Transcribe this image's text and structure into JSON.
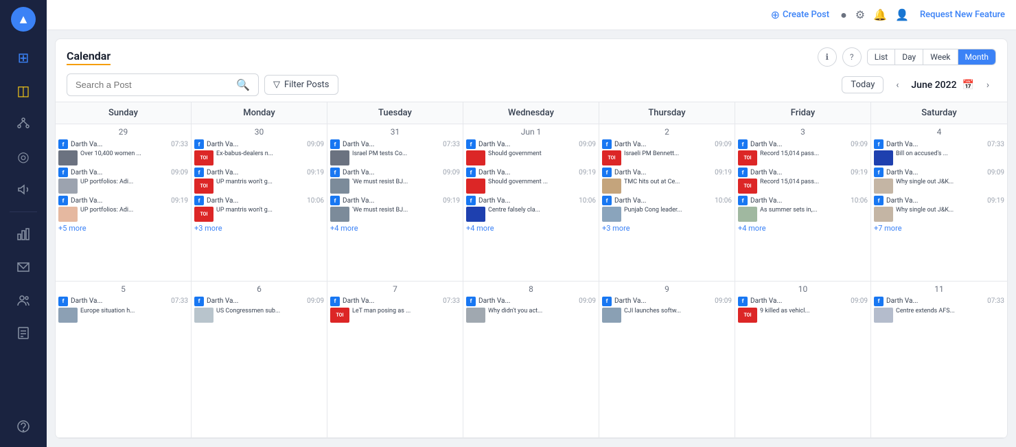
{
  "sidebar": {
    "logo_icon": "▲",
    "items": [
      {
        "id": "dashboard",
        "icon": "⊞",
        "active": false
      },
      {
        "id": "posts",
        "icon": "◫",
        "active": true,
        "color": "yellow"
      },
      {
        "id": "network",
        "icon": "✦",
        "active": false
      },
      {
        "id": "target",
        "icon": "◎",
        "active": false
      },
      {
        "id": "megaphone",
        "icon": "📣",
        "active": false
      },
      {
        "id": "analytics",
        "icon": "📊",
        "active": false
      },
      {
        "id": "inbox",
        "icon": "📥",
        "active": false
      },
      {
        "id": "team",
        "icon": "👥",
        "active": false
      },
      {
        "id": "reports",
        "icon": "📋",
        "active": false
      },
      {
        "id": "support",
        "icon": "🎧",
        "active": false
      }
    ]
  },
  "topbar": {
    "create_post": "Create Post",
    "request_feature": "Request New Feature"
  },
  "calendar": {
    "title": "Calendar",
    "search_placeholder": "Search a Post",
    "filter_label": "Filter Posts",
    "today_label": "Today",
    "month_label": "June 2022",
    "view_tabs": [
      "List",
      "Day",
      "Week",
      "Month"
    ],
    "active_view": "Month",
    "day_headers": [
      "Sunday",
      "Monday",
      "Tuesday",
      "Wednesday",
      "Thursday",
      "Friday",
      "Saturday"
    ],
    "weeks": [
      {
        "days": [
          {
            "date": "29",
            "posts": [
              {
                "source": "fb",
                "title": "Darth Va...",
                "time": "07:33",
                "thumb": "gray",
                "content": "Over 10,400 women ..."
              },
              {
                "source": "fb",
                "title": "Darth Va...",
                "time": "09:09",
                "thumb": "gray",
                "content": "UP portfolios: Adi..."
              },
              {
                "source": "fb",
                "title": "Darth Va...",
                "time": "09:19",
                "thumb": "gray",
                "content": "UP portfolios: Adi..."
              }
            ],
            "more": "+5 more"
          },
          {
            "date": "30",
            "posts": [
              {
                "source": "fb",
                "title": "Darth Va...",
                "time": "09:09",
                "thumb": "toi",
                "content": "Ex-babus-dealers n..."
              },
              {
                "source": "fb",
                "title": "Darth Va...",
                "time": "09:19",
                "thumb": "toi",
                "content": "UP mantris won't g..."
              },
              {
                "source": "fb",
                "title": "Darth Va...",
                "time": "10:06",
                "thumb": "toi",
                "content": "UP mantris won't g..."
              }
            ],
            "more": "+3 more"
          },
          {
            "date": "31",
            "posts": [
              {
                "source": "fb",
                "title": "Darth Va...",
                "time": "07:33",
                "thumb": "person",
                "content": "Israel PM tests Co..."
              },
              {
                "source": "fb",
                "title": "Darth Va...",
                "time": "09:09",
                "thumb": "person",
                "content": "'We must resist BJ..."
              },
              {
                "source": "fb",
                "title": "Darth Va...",
                "time": "09:19",
                "thumb": "person",
                "content": "'We must resist BJ..."
              }
            ],
            "more": "+4 more"
          },
          {
            "date": "Jun 1",
            "posts": [
              {
                "source": "fb",
                "title": "Darth Va...",
                "time": "09:09",
                "thumb": "red",
                "content": "Should government"
              },
              {
                "source": "fb",
                "title": "Darth Va...",
                "time": "09:19",
                "thumb": "red",
                "content": "Should government"
              },
              {
                "source": "fb",
                "title": "Darth Va...",
                "time": "10:06",
                "thumb": "blue",
                "content": "Centre falsely cla..."
              }
            ],
            "more": "+4 more"
          },
          {
            "date": "2",
            "posts": [
              {
                "source": "fb",
                "title": "Darth Va...",
                "time": "09:09",
                "thumb": "toi",
                "content": "Israeli PM Bennett..."
              },
              {
                "source": "fb",
                "title": "Darth Va...",
                "time": "09:19",
                "thumb": "person",
                "content": "TMC hits out at Ce..."
              },
              {
                "source": "fb",
                "title": "Darth Va...",
                "time": "10:06",
                "thumb": "person",
                "content": "Punjab Cong leader..."
              }
            ],
            "more": "+3 more"
          },
          {
            "date": "3",
            "posts": [
              {
                "source": "fb",
                "title": "Darth Va...",
                "time": "09:09",
                "thumb": "toi",
                "content": "Record 15,014 pass..."
              },
              {
                "source": "fb",
                "title": "Darth Va...",
                "time": "09:19",
                "thumb": "toi",
                "content": "Record 15,014 pass..."
              },
              {
                "source": "fb",
                "title": "Darth Va...",
                "time": "10:06",
                "thumb": "gray",
                "content": "As summer sets in,..."
              }
            ],
            "more": "+4 more"
          },
          {
            "date": "4",
            "posts": [
              {
                "source": "fb",
                "title": "Darth Va...",
                "time": "07:33",
                "thumb": "blue",
                "content": "Bill on accused's ..."
              },
              {
                "source": "fb",
                "title": "Darth Va...",
                "time": "09:09",
                "thumb": "gray",
                "content": "Why single out J&K..."
              },
              {
                "source": "fb",
                "title": "Darth Va...",
                "time": "09:19",
                "thumb": "gray",
                "content": "Why single out J&K..."
              }
            ],
            "more": "+7 more"
          }
        ]
      },
      {
        "days": [
          {
            "date": "5",
            "posts": [
              {
                "source": "fb",
                "title": "Darth Va...",
                "time": "07:33",
                "thumb": "gray",
                "content": "Europe situation h..."
              }
            ],
            "more": ""
          },
          {
            "date": "6",
            "posts": [
              {
                "source": "fb",
                "title": "Darth Va...",
                "time": "09:09",
                "thumb": "gray",
                "content": "US Congressmen sub..."
              }
            ],
            "more": ""
          },
          {
            "date": "7",
            "posts": [
              {
                "source": "fb",
                "title": "Darth Va...",
                "time": "07:33",
                "thumb": "toi",
                "content": "LeT man posing as ..."
              }
            ],
            "more": ""
          },
          {
            "date": "8",
            "posts": [
              {
                "source": "fb",
                "title": "Darth Va...",
                "time": "09:09",
                "thumb": "gray",
                "content": "Why didn't you act..."
              }
            ],
            "more": ""
          },
          {
            "date": "9",
            "posts": [
              {
                "source": "fb",
                "title": "Darth Va...",
                "time": "09:09",
                "thumb": "gray",
                "content": "CJI launches softw..."
              }
            ],
            "more": ""
          },
          {
            "date": "10",
            "posts": [
              {
                "source": "fb",
                "title": "Darth Va...",
                "time": "09:09",
                "thumb": "toi",
                "content": "9 killed as vehicl..."
              }
            ],
            "more": ""
          },
          {
            "date": "11",
            "posts": [
              {
                "source": "fb",
                "title": "Darth Va...",
                "time": "07:33",
                "thumb": "gray",
                "content": "Centre extends AFS..."
              }
            ],
            "more": ""
          }
        ]
      }
    ]
  }
}
